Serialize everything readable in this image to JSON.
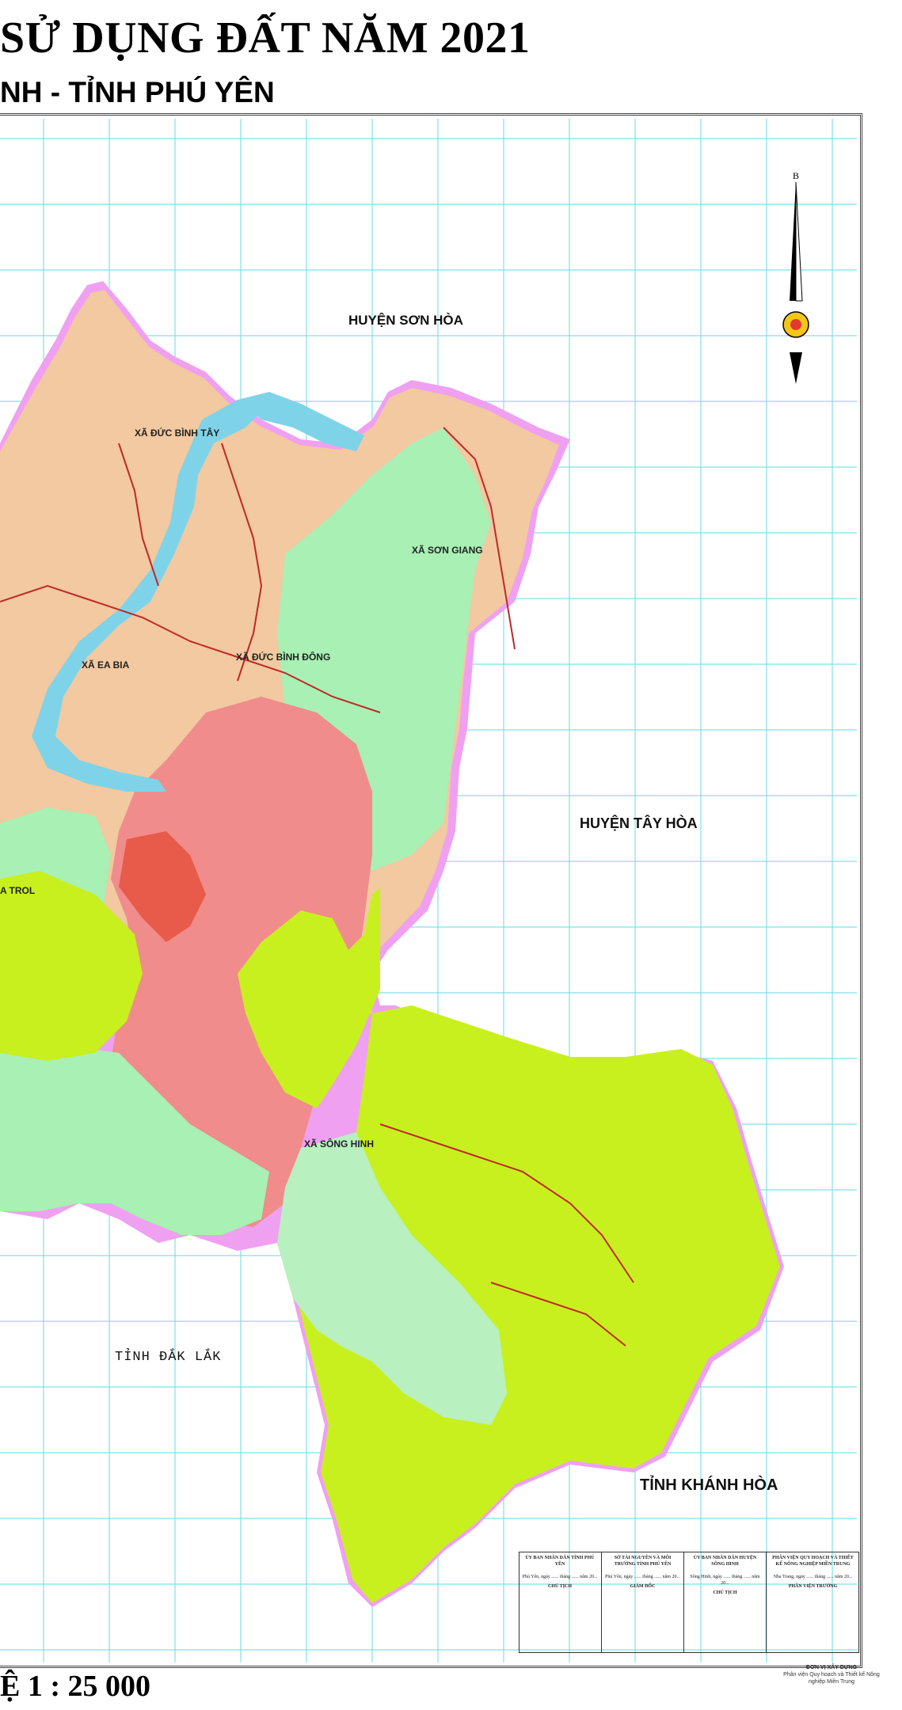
{
  "header": {
    "title": "SỬ DỤNG ĐẤT NĂM 2021",
    "subtitle": "NH - TỈNH PHÚ YÊN"
  },
  "footer": {
    "scale": "Ệ 1 : 25 000",
    "designer_line1": "ĐƠN VỊ XÂY DỰNG",
    "designer_line2": "Phân viện Quy hoạch và Thiết kế Nông nghiệp Miền Trung"
  },
  "map": {
    "north_letter": "B",
    "regions": {
      "son_hoa": "HUYỆN SƠN HÒA",
      "tay_hoa": "HUYỆN TÂY HÒA",
      "dak_lak": "TỈNH ĐẮK LẮK",
      "khanh_hoa": "TỈNH KHÁNH HÒA"
    },
    "communes": {
      "duc_binh_tay": "XÃ ĐỨC BÌNH TÂY",
      "son_giang": "XÃ SƠN GIANG",
      "ea_bia": "XÃ EA BIA",
      "duc_binh_dong": "XÃ ĐỨC BÌNH ĐÔNG",
      "ea_trol": "A TROL",
      "song_hinh": "XÃ SÔNG HINH"
    },
    "colors": {
      "agricultural": "#f2c9a0",
      "forest_production": "#a8f0b4",
      "forest_protection": "#c8f01e",
      "residential": "#f08c8c",
      "water": "#7fd3e8",
      "boundary": "#f0a0f0",
      "grid": "#7fe0e8"
    }
  },
  "signature_table": [
    {
      "org": "ỦY BAN NHÂN DÂN TỈNH PHÚ YÊN",
      "date": "Phú Yên, ngày ...... tháng ...... năm 20...",
      "role": "CHỦ TỊCH"
    },
    {
      "org": "SỞ TÀI NGUYÊN VÀ MÔI TRƯỜNG TỈNH PHÚ YÊN",
      "date": "Phú Yên, ngày ...... tháng ...... năm 20...",
      "role": "GIÁM ĐỐC"
    },
    {
      "org": "ỦY BAN NHÂN DÂN HUYỆN SÔNG HINH",
      "date": "Sông Hinh, ngày ...... tháng ...... năm 20...",
      "role": "CHỦ TỊCH"
    },
    {
      "org": "PHÂN VIỆN QUY HOẠCH VÀ THIẾT KẾ NÔNG NGHIỆP MIỀN TRUNG",
      "date": "Nha Trang, ngày ...... tháng ...... năm 20...",
      "role": "PHÂN VIỆN TRƯỞNG"
    }
  ]
}
